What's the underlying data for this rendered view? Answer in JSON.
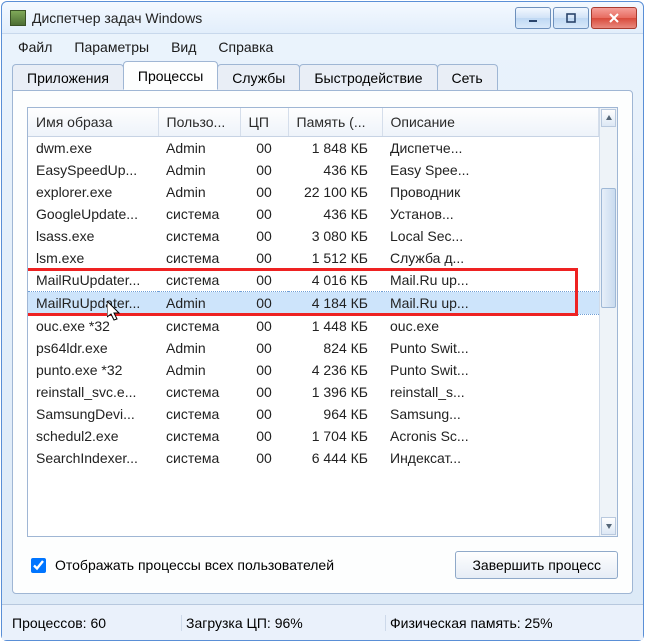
{
  "window": {
    "title": "Диспетчер задач Windows"
  },
  "menu": {
    "file": "Файл",
    "params": "Параметры",
    "view": "Вид",
    "help": "Справка"
  },
  "tabs": {
    "apps": "Приложения",
    "processes": "Процессы",
    "services": "Службы",
    "performance": "Быстродействие",
    "network": "Сеть"
  },
  "columns": {
    "image_name": "Имя образа",
    "user": "Пользо...",
    "cpu": "ЦП",
    "memory": "Память (...",
    "description": "Описание"
  },
  "rows": [
    {
      "name": "dwm.exe",
      "user": "Admin",
      "cpu": "00",
      "mem": "1 848 КБ",
      "desc": "Диспетче..."
    },
    {
      "name": "EasySpeedUp...",
      "user": "Admin",
      "cpu": "00",
      "mem": "436 КБ",
      "desc": "Easy Spee..."
    },
    {
      "name": "explorer.exe",
      "user": "Admin",
      "cpu": "00",
      "mem": "22 100 КБ",
      "desc": "Проводник"
    },
    {
      "name": "GoogleUpdate...",
      "user": "система",
      "cpu": "00",
      "mem": "436 КБ",
      "desc": "Установ..."
    },
    {
      "name": "lsass.exe",
      "user": "система",
      "cpu": "00",
      "mem": "3 080 КБ",
      "desc": "Local Sec..."
    },
    {
      "name": "lsm.exe",
      "user": "система",
      "cpu": "00",
      "mem": "1 512 КБ",
      "desc": "Служба д..."
    },
    {
      "name": "MailRuUpdater...",
      "user": "система",
      "cpu": "00",
      "mem": "4 016 КБ",
      "desc": "Mail.Ru up..."
    },
    {
      "name": "MailRuUpdater...",
      "user": "Admin",
      "cpu": "00",
      "mem": "4 184 КБ",
      "desc": "Mail.Ru up..."
    },
    {
      "name": "ouc.exe *32",
      "user": "система",
      "cpu": "00",
      "mem": "1 448 КБ",
      "desc": "ouc.exe"
    },
    {
      "name": "ps64ldr.exe",
      "user": "Admin",
      "cpu": "00",
      "mem": "824 КБ",
      "desc": "Punto Swit..."
    },
    {
      "name": "punto.exe *32",
      "user": "Admin",
      "cpu": "00",
      "mem": "4 236 КБ",
      "desc": "Punto Swit..."
    },
    {
      "name": "reinstall_svc.e...",
      "user": "система",
      "cpu": "00",
      "mem": "1 396 КБ",
      "desc": "reinstall_s..."
    },
    {
      "name": "SamsungDevi...",
      "user": "система",
      "cpu": "00",
      "mem": "964 КБ",
      "desc": "Samsung..."
    },
    {
      "name": "schedul2.exe",
      "user": "система",
      "cpu": "00",
      "mem": "1 704 КБ",
      "desc": "Acronis Sc..."
    },
    {
      "name": "SearchIndexer...",
      "user": "система",
      "cpu": "00",
      "mem": "6 444 КБ",
      "desc": "Индексат..."
    }
  ],
  "selected_row_index": 7,
  "highlight_rows": [
    6,
    7
  ],
  "footer": {
    "show_all_users_label": "Отображать процессы всех пользователей",
    "show_all_users_checked": true,
    "end_process_button": "Завершить процесс"
  },
  "status": {
    "processes": "Процессов: 60",
    "cpu_load": "Загрузка ЦП: 96%",
    "phys_mem": "Физическая память: 25%"
  }
}
